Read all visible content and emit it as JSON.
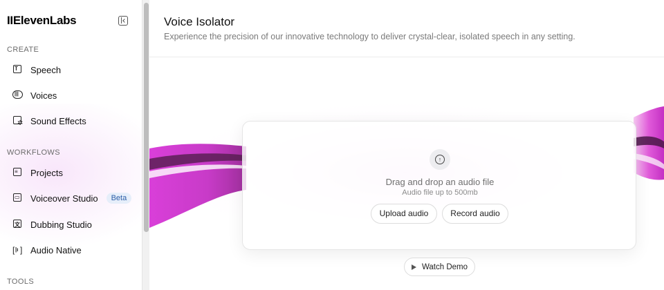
{
  "app": {
    "logo": "IIElevenLabs"
  },
  "sidebar": {
    "sections": {
      "create": "CREATE",
      "workflows": "WORKFLOWS",
      "tools": "TOOLS"
    },
    "items": [
      {
        "label": "Speech",
        "icon": "speech-icon"
      },
      {
        "label": "Voices",
        "icon": "voices-icon"
      },
      {
        "label": "Sound Effects",
        "icon": "sound-effects-icon"
      },
      {
        "label": "Projects",
        "icon": "projects-icon"
      },
      {
        "label": "Voiceover Studio",
        "icon": "voiceover-icon",
        "badge": "Beta"
      },
      {
        "label": "Dubbing Studio",
        "icon": "dubbing-icon"
      },
      {
        "label": "Audio Native",
        "icon": "audio-native-icon"
      }
    ]
  },
  "header": {
    "title": "Voice Isolator",
    "subtitle": "Experience the precision of our innovative technology to deliver crystal-clear, isolated speech in any setting."
  },
  "dropzone": {
    "title": "Drag and drop an audio file",
    "subtitle": "Audio file up to 500mb",
    "upload_label": "Upload audio",
    "record_label": "Record audio"
  },
  "demo": {
    "label": "Watch Demo"
  },
  "colors": {
    "accent_magenta": "#d43ad6",
    "badge_bg": "#e6eefa",
    "badge_text": "#2d5ea8"
  }
}
